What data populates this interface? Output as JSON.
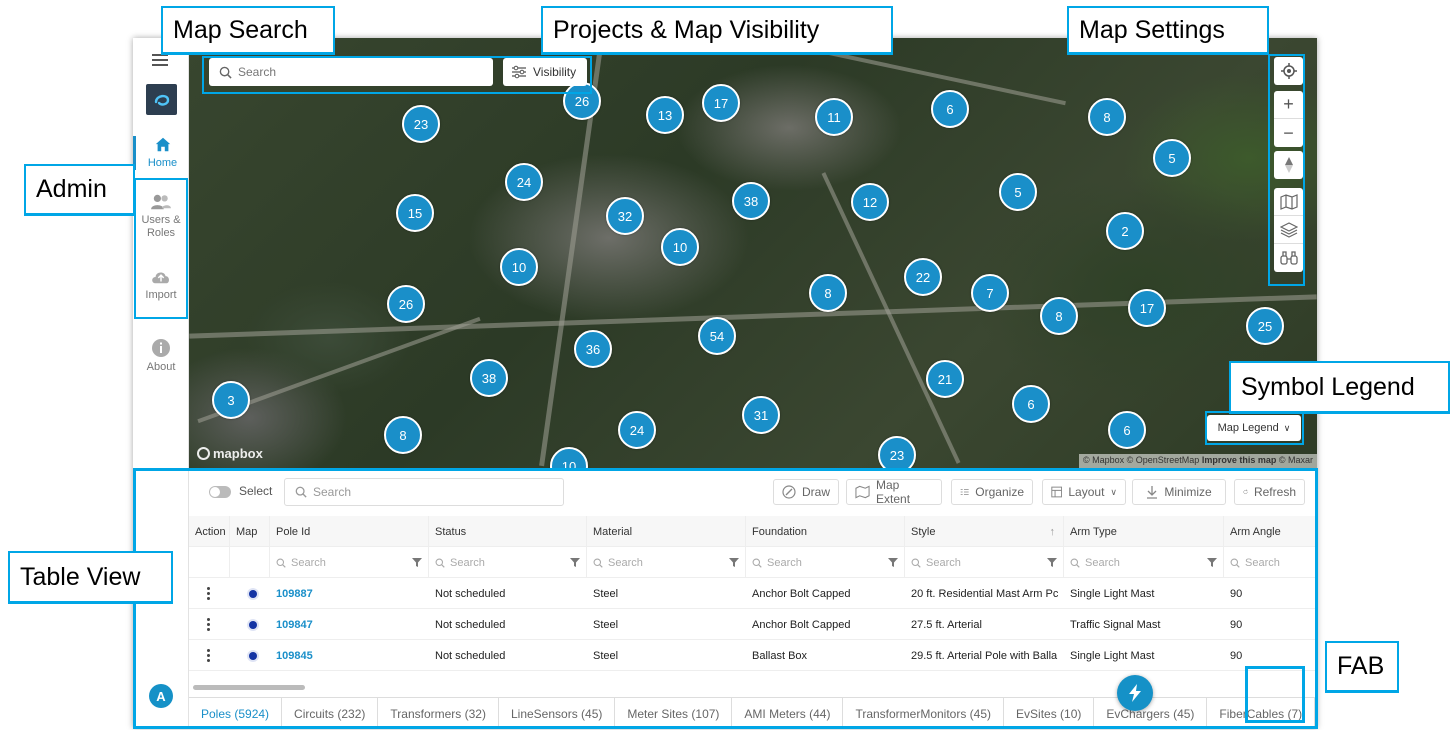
{
  "annotations": {
    "map_search": "Map Search",
    "projects_visibility": "Projects & Map Visibility",
    "map_settings": "Map Settings",
    "admin": "Admin",
    "symbol_legend": "Symbol Legend",
    "table_view": "Table View",
    "fab": "FAB"
  },
  "sidebar": {
    "home": "Home",
    "users_roles": "Users &\nRoles",
    "import": "Import",
    "about": "About",
    "avatar_initial": "A"
  },
  "map": {
    "search_placeholder": "Search",
    "visibility_label": "Visibility",
    "legend_label": "Map Legend",
    "mapbox_logo": "mapbox",
    "attribution": "© Mapbox © OpenStreetMap",
    "attribution_link": "Improve this map",
    "attribution_tail": "© Maxar",
    "clusters": [
      {
        "n": "23"
      },
      {
        "n": "26"
      },
      {
        "n": "13"
      },
      {
        "n": "17"
      },
      {
        "n": "11"
      },
      {
        "n": "6"
      },
      {
        "n": "8"
      },
      {
        "n": "5"
      },
      {
        "n": "24"
      },
      {
        "n": "15"
      },
      {
        "n": "32"
      },
      {
        "n": "38"
      },
      {
        "n": "12"
      },
      {
        "n": "5"
      },
      {
        "n": "2"
      },
      {
        "n": "10"
      },
      {
        "n": "10"
      },
      {
        "n": "22"
      },
      {
        "n": "7"
      },
      {
        "n": "8"
      },
      {
        "n": "8"
      },
      {
        "n": "17"
      },
      {
        "n": "26"
      },
      {
        "n": "54"
      },
      {
        "n": "36"
      },
      {
        "n": "25"
      },
      {
        "n": "38"
      },
      {
        "n": "21"
      },
      {
        "n": "3"
      },
      {
        "n": "6"
      },
      {
        "n": "31"
      },
      {
        "n": "24"
      },
      {
        "n": "6"
      },
      {
        "n": "8"
      },
      {
        "n": "23"
      },
      {
        "n": "10"
      }
    ]
  },
  "table": {
    "select_label": "Select",
    "search_placeholder": "Search",
    "buttons": {
      "draw": "Draw",
      "map_extent": "Map Extent",
      "organize": "Organize",
      "layout": "Layout",
      "minimize": "Minimize",
      "refresh": "Refresh"
    },
    "columns": [
      "Action",
      "Map",
      "Pole Id",
      "Status",
      "Material",
      "Foundation",
      "Style",
      "Arm Type",
      "Arm Angle"
    ],
    "filter_placeholder": "Search",
    "rows": [
      {
        "pole_id": "109887",
        "status": "Not scheduled",
        "material": "Steel",
        "foundation": "Anchor Bolt Capped",
        "style": "20 ft. Residential Mast Arm Pc",
        "arm_type": "Single Light Mast",
        "arm_angle": "90"
      },
      {
        "pole_id": "109847",
        "status": "Not scheduled",
        "material": "Steel",
        "foundation": "Anchor Bolt Capped",
        "style": "27.5 ft. Arterial",
        "arm_type": "Traffic Signal Mast",
        "arm_angle": "90"
      },
      {
        "pole_id": "109845",
        "status": "Not scheduled",
        "material": "Steel",
        "foundation": "Ballast Box",
        "style": "29.5 ft. Arterial Pole with Balla",
        "arm_type": "Single Light Mast",
        "arm_angle": "90"
      }
    ],
    "tabs": [
      "Poles (5924)",
      "Circuits (232)",
      "Transformers (32)",
      "LineSensors (45)",
      "Meter Sites (107)",
      "AMI Meters (44)",
      "TransformerMonitors (45)",
      "EvSites (10)",
      "EvChargers (45)",
      "FiberCables (7)"
    ]
  },
  "colors": {
    "accent": "#1a8fc9",
    "callout": "#00a6e6",
    "map_dot": "#1434a4"
  }
}
